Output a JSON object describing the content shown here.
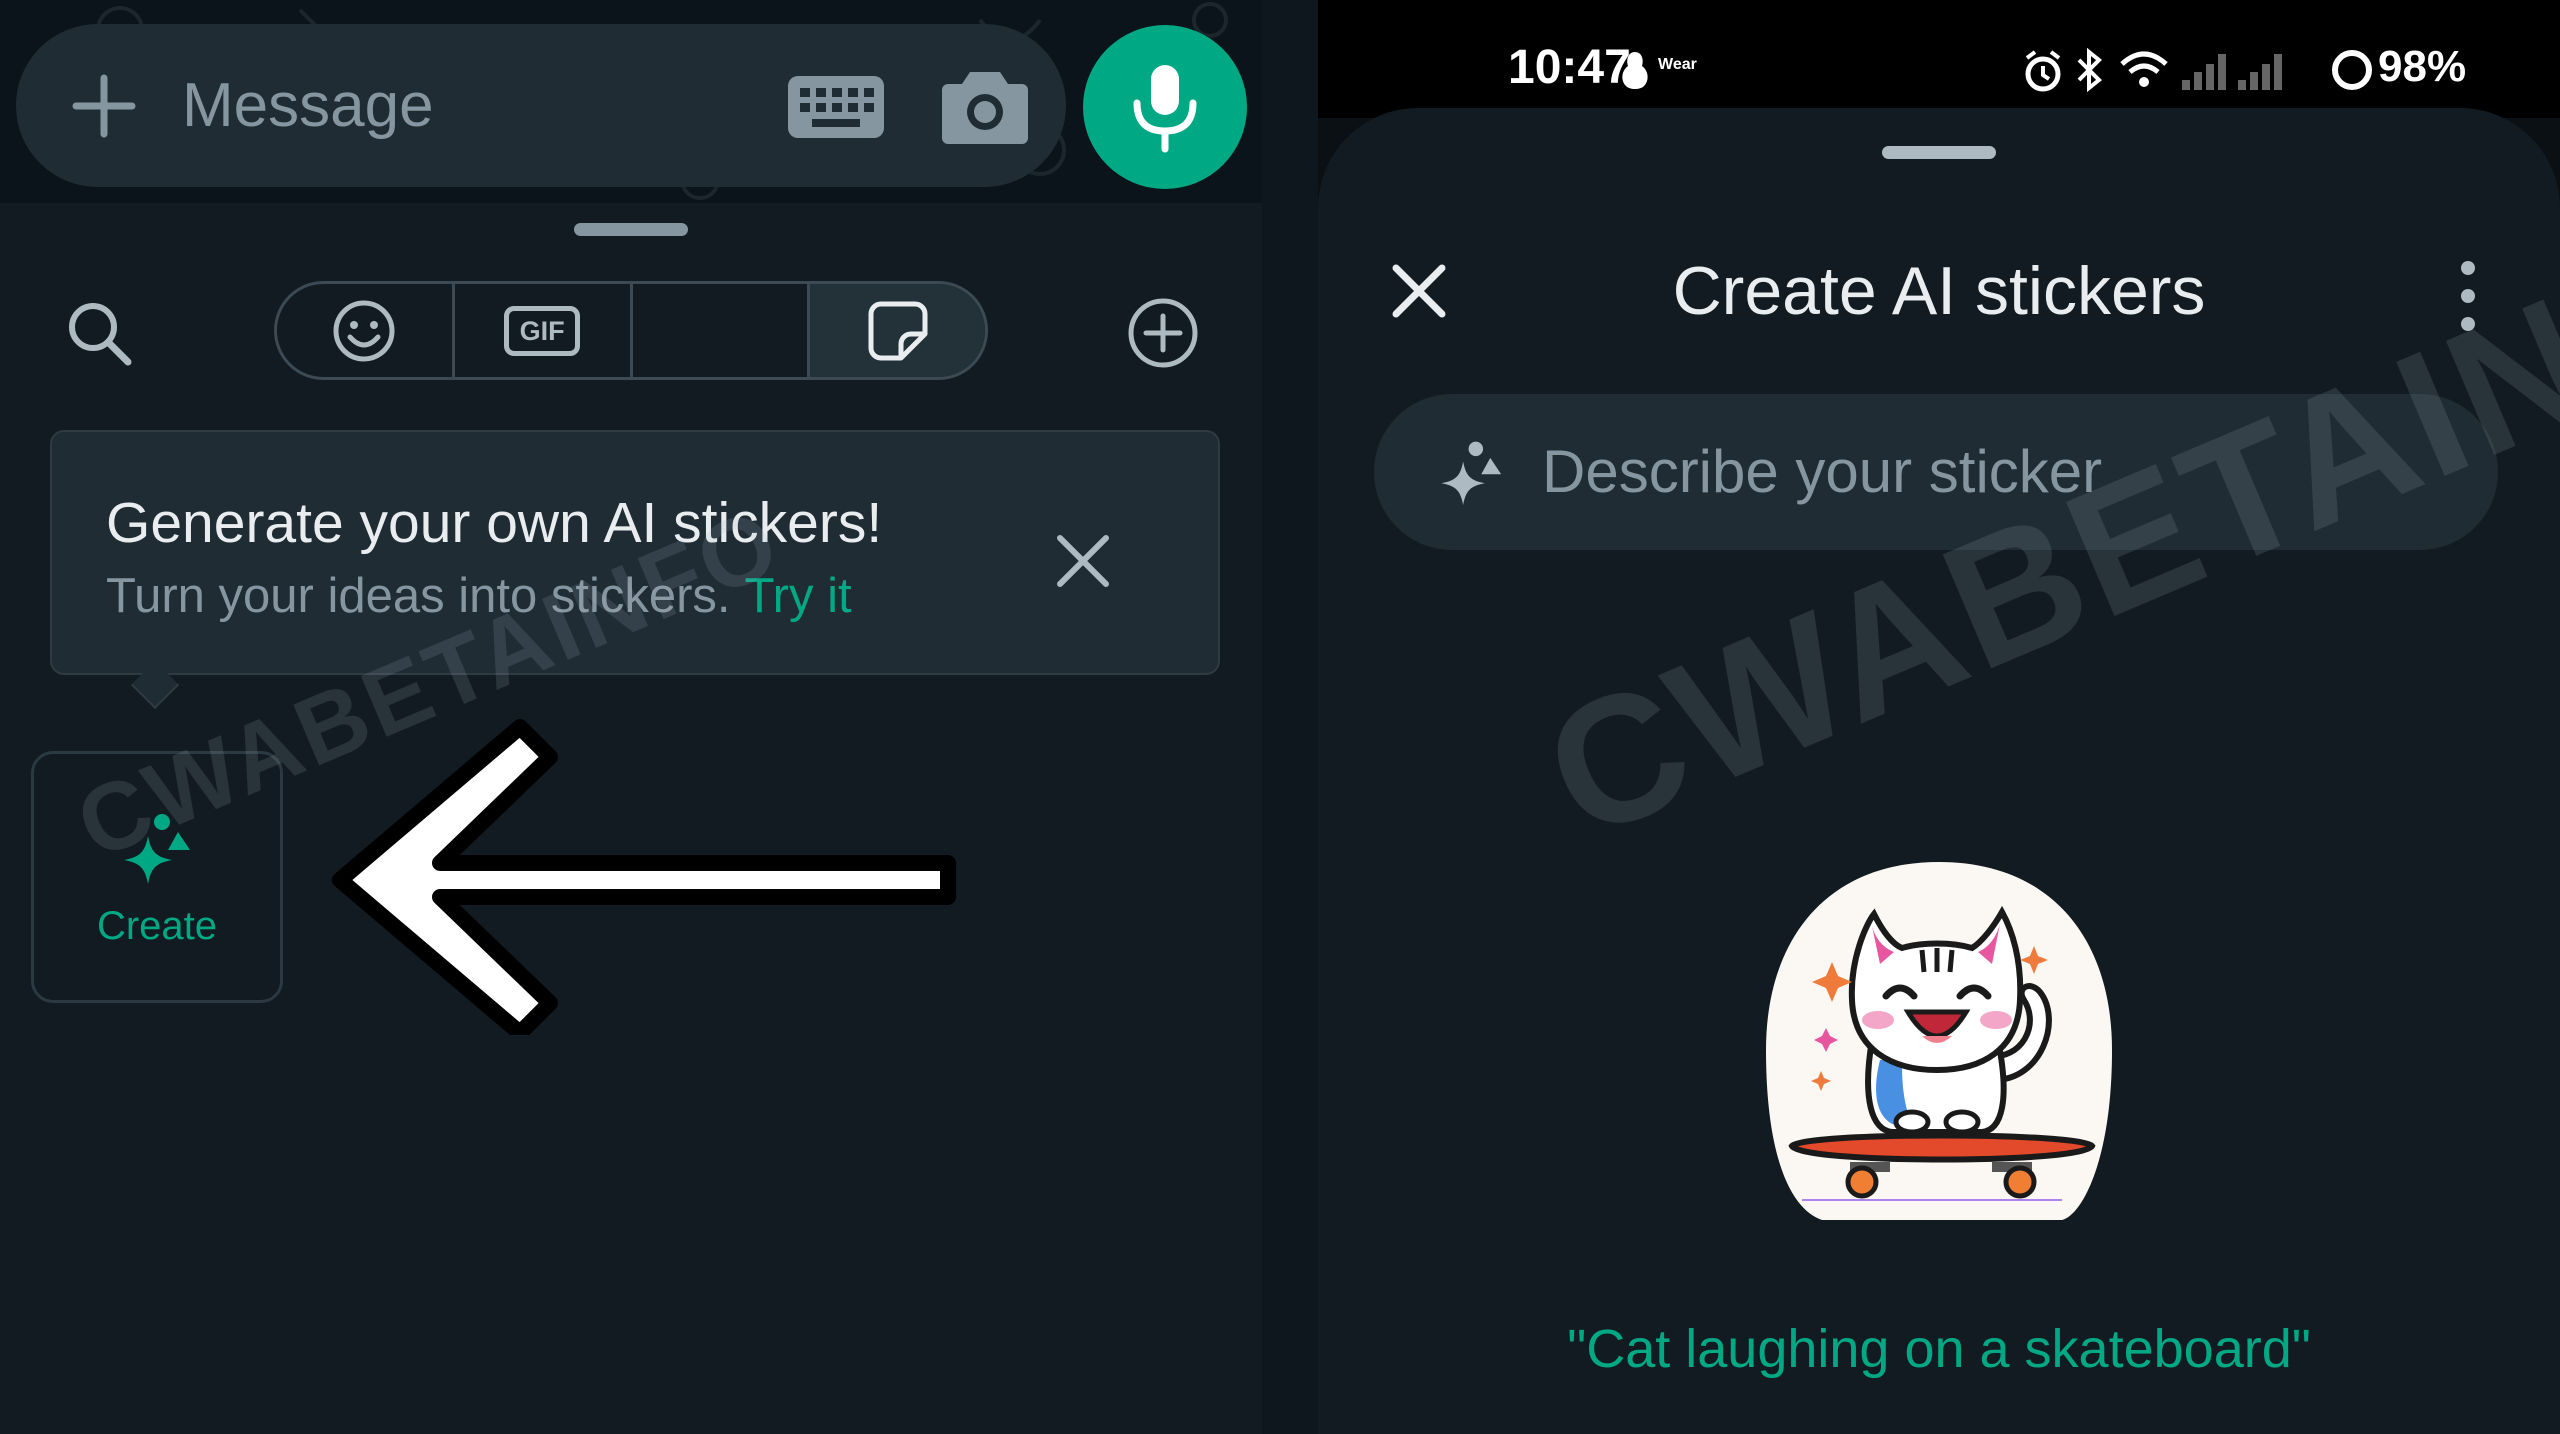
{
  "left_panel": {
    "message_bar": {
      "placeholder": "Message",
      "icons": [
        "plus-icon",
        "keyboard-icon",
        "camera-icon"
      ]
    },
    "mic_button": {
      "icon": "mic-icon",
      "color": "#00a884"
    },
    "picker_tabs": [
      {
        "name": "emoji",
        "icon": "emoji-icon"
      },
      {
        "name": "gif",
        "label": "GIF",
        "icon": "gif-icon"
      },
      {
        "name": "avatar",
        "icon": "avatar-icon"
      },
      {
        "name": "stickers",
        "icon": "sticker-icon",
        "selected": true
      }
    ],
    "ai_banner": {
      "title": "Generate your own AI stickers!",
      "subtitle": "Turn your ideas into stickers.",
      "link": "Try it"
    },
    "create_tile": {
      "label": "Create",
      "icon": "ai-sparkle-icon"
    },
    "watermark": "CWABETAINFO"
  },
  "right_panel": {
    "status_bar": {
      "time": "10:47",
      "wear_label": "Wear",
      "battery": "98%",
      "icons": [
        "alarm-icon",
        "bluetooth-icon",
        "wifi-icon",
        "signal-icon",
        "battery-ring-icon"
      ]
    },
    "sheet": {
      "title": "Create AI stickers",
      "input_placeholder": "Describe your sticker",
      "sample_caption": "\"Cat laughing on a skateboard\""
    },
    "watermark": "CWABETAINFO"
  },
  "colors": {
    "accent": "#00a884",
    "background": "#111b21",
    "surface": "#202c33"
  }
}
